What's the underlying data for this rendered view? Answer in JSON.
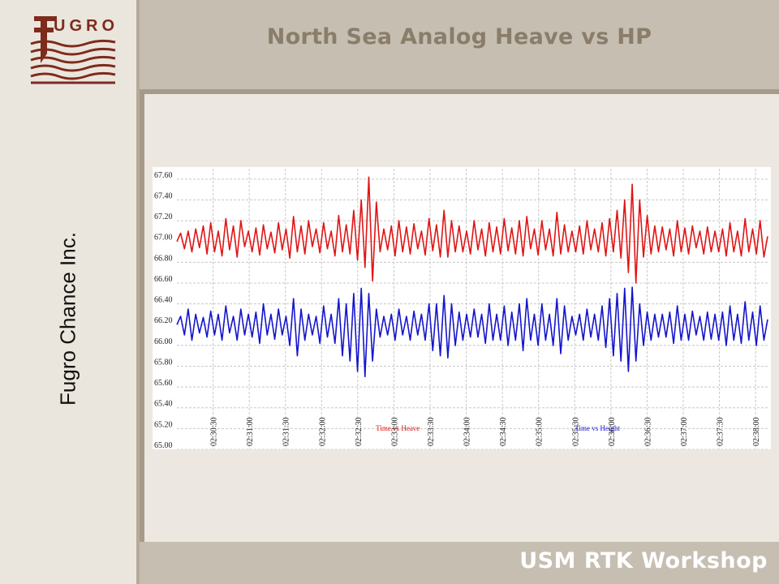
{
  "header": {
    "title": "North Sea Analog Heave vs HP"
  },
  "sidebar": {
    "company": "Fugro Chance Inc.",
    "logo_text": "UGRO"
  },
  "footer": {
    "text": "USM  RTK Workshop"
  },
  "colors": {
    "heave": "#e01515",
    "height": "#1515cc",
    "grid": "#c8c8c8",
    "brand": "#8a7d6a"
  },
  "chart_data": {
    "type": "line",
    "title": "",
    "xlabel": "",
    "ylabel": "",
    "ylim": [
      65.0,
      67.7
    ],
    "yticks": [
      "65.00",
      "65.20",
      "65.40",
      "65.60",
      "65.80",
      "66.00",
      "66.20",
      "66.40",
      "66.60",
      "66.80",
      "67.00",
      "67.20",
      "67.40",
      "67.60"
    ],
    "xlim": [
      "02:30:00",
      "02:38:10"
    ],
    "xticks": [
      "02:30:30",
      "02:31:00",
      "02:31:30",
      "02:32:00",
      "02:32:30",
      "02:33:00",
      "02:33:30",
      "02:34:00",
      "02:34:30",
      "02:35:00",
      "02:35:30",
      "02:36:00",
      "02:36:30",
      "02:37:00",
      "02:37:30",
      "02:38:00"
    ],
    "grid": true,
    "series": [
      {
        "name": "Time vs Heave",
        "color": "#e01515",
        "baseline": 67.0,
        "values": [
          67.0,
          67.08,
          66.93,
          67.1,
          66.9,
          67.12,
          66.94,
          67.15,
          66.88,
          67.18,
          66.9,
          67.1,
          66.86,
          67.22,
          66.92,
          67.15,
          66.85,
          67.2,
          66.95,
          67.1,
          66.9,
          67.13,
          66.87,
          67.16,
          66.93,
          67.09,
          66.89,
          67.18,
          66.92,
          67.12,
          66.84,
          67.24,
          66.9,
          67.15,
          66.88,
          67.2,
          66.95,
          67.12,
          66.89,
          67.18,
          66.93,
          67.1,
          66.86,
          67.25,
          66.9,
          67.16,
          66.88,
          67.3,
          66.82,
          67.4,
          66.75,
          67.62,
          66.62,
          67.38,
          66.9,
          67.12,
          66.92,
          67.15,
          66.86,
          67.2,
          66.9,
          67.14,
          66.88,
          67.17,
          66.93,
          67.1,
          66.87,
          67.22,
          66.91,
          67.16,
          66.85,
          67.3,
          66.85,
          67.2,
          66.9,
          67.15,
          66.9,
          67.1,
          66.88,
          67.2,
          66.92,
          67.12,
          66.86,
          67.18,
          66.9,
          67.14,
          66.88,
          67.22,
          66.91,
          67.13,
          66.88,
          67.2,
          66.86,
          67.24,
          66.93,
          67.12,
          66.87,
          67.2,
          66.92,
          67.12,
          66.86,
          67.28,
          66.88,
          67.16,
          66.9,
          67.1,
          66.9,
          67.15,
          66.88,
          67.2,
          66.92,
          67.12,
          66.9,
          67.18,
          66.86,
          67.22,
          66.9,
          67.3,
          66.84,
          67.4,
          66.7,
          67.55,
          66.6,
          67.4,
          66.85,
          67.25,
          66.88,
          67.15,
          66.9,
          67.14,
          66.92,
          67.12,
          66.86,
          67.2,
          66.9,
          67.13,
          66.88,
          67.15,
          66.94,
          67.1,
          66.88,
          67.14,
          66.9,
          67.1,
          66.9,
          67.12,
          66.86,
          67.18,
          66.9,
          67.1,
          66.86,
          67.22,
          66.9,
          67.12,
          66.88,
          67.2,
          66.85,
          67.05
        ]
      },
      {
        "name": "Time vs Height",
        "color": "#1515cc",
        "baseline": 66.2,
        "values": [
          66.2,
          66.28,
          66.1,
          66.35,
          66.05,
          66.3,
          66.12,
          66.27,
          66.08,
          66.33,
          66.1,
          66.3,
          66.05,
          66.38,
          66.12,
          66.28,
          66.05,
          66.35,
          66.1,
          66.3,
          66.08,
          66.32,
          66.02,
          66.4,
          66.1,
          66.3,
          66.06,
          66.35,
          66.1,
          66.28,
          66.0,
          66.45,
          65.9,
          66.35,
          66.05,
          66.3,
          66.1,
          66.28,
          66.02,
          66.38,
          66.08,
          66.3,
          66.02,
          66.45,
          65.9,
          66.4,
          65.85,
          66.5,
          65.75,
          66.55,
          65.7,
          66.5,
          65.85,
          66.35,
          66.08,
          66.28,
          66.1,
          66.3,
          66.05,
          66.35,
          66.1,
          66.28,
          66.05,
          66.33,
          66.1,
          66.3,
          66.05,
          66.4,
          65.95,
          66.4,
          65.9,
          66.48,
          65.88,
          66.4,
          66.0,
          66.32,
          66.05,
          66.3,
          66.08,
          66.35,
          66.08,
          66.3,
          66.02,
          66.4,
          66.05,
          66.3,
          66.05,
          66.38,
          66.0,
          66.32,
          66.05,
          66.4,
          65.95,
          66.45,
          66.05,
          66.3,
          66.0,
          66.4,
          66.05,
          66.3,
          66.0,
          66.45,
          65.92,
          66.38,
          66.05,
          66.28,
          66.1,
          66.3,
          66.05,
          66.35,
          66.08,
          66.3,
          66.05,
          66.38,
          65.98,
          66.45,
          65.9,
          66.5,
          65.85,
          66.55,
          65.75,
          66.56,
          65.85,
          66.4,
          66.0,
          66.32,
          66.05,
          66.3,
          66.08,
          66.3,
          66.08,
          66.32,
          66.02,
          66.38,
          66.05,
          66.3,
          66.05,
          66.33,
          66.1,
          66.28,
          66.05,
          66.32,
          66.06,
          66.3,
          66.05,
          66.32,
          66.0,
          66.38,
          66.05,
          66.3,
          66.02,
          66.42,
          66.05,
          66.32,
          66.0,
          66.38,
          66.05,
          66.25
        ]
      }
    ],
    "annotations": [
      {
        "text": "Time vs Heave",
        "color": "#e01515",
        "at_x": "02:32:45",
        "at_y": 65.18
      },
      {
        "text": "Time vs Height",
        "color": "#1515cc",
        "at_x": "02:35:30",
        "at_y": 65.18
      }
    ]
  }
}
